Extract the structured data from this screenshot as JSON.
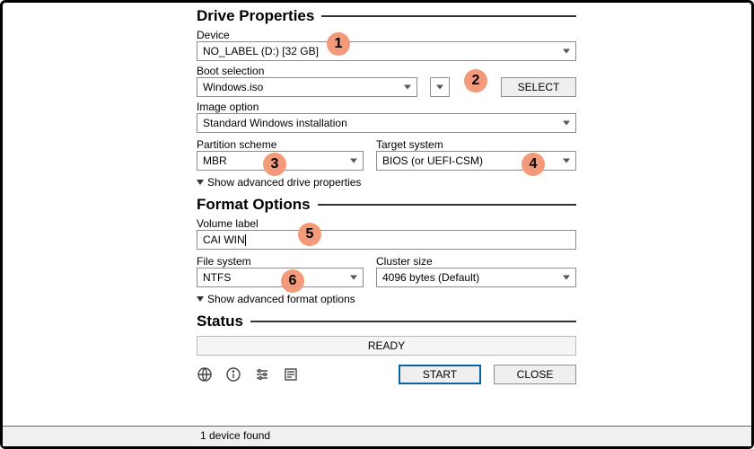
{
  "sections": {
    "drive": "Drive Properties",
    "format": "Format Options",
    "status": "Status"
  },
  "labels": {
    "device": "Device",
    "boot_selection": "Boot selection",
    "image_option": "Image option",
    "partition_scheme": "Partition scheme",
    "target_system": "Target system",
    "volume_label": "Volume label",
    "file_system": "File system",
    "cluster_size": "Cluster size"
  },
  "values": {
    "device": "NO_LABEL (D:) [32 GB]",
    "boot_selection": "Windows.iso",
    "image_option": "Standard Windows installation",
    "partition_scheme": "MBR",
    "target_system": "BIOS (or UEFI-CSM)",
    "volume_label": "CAI WIN",
    "file_system": "NTFS",
    "cluster_size": "4096 bytes (Default)"
  },
  "toggles": {
    "advanced_drive": "Show advanced drive properties",
    "advanced_format": "Show advanced format options"
  },
  "buttons": {
    "select": "SELECT",
    "start": "START",
    "close": "CLOSE"
  },
  "status": {
    "text": "READY"
  },
  "footer": {
    "devices": "1 device found"
  },
  "icons": {
    "lang": "language-icon",
    "info": "info-icon",
    "settings": "settings-icon",
    "log": "log-icon"
  },
  "annotations": {
    "1": "1",
    "2": "2",
    "3": "3",
    "4": "4",
    "5": "5",
    "6": "6"
  }
}
